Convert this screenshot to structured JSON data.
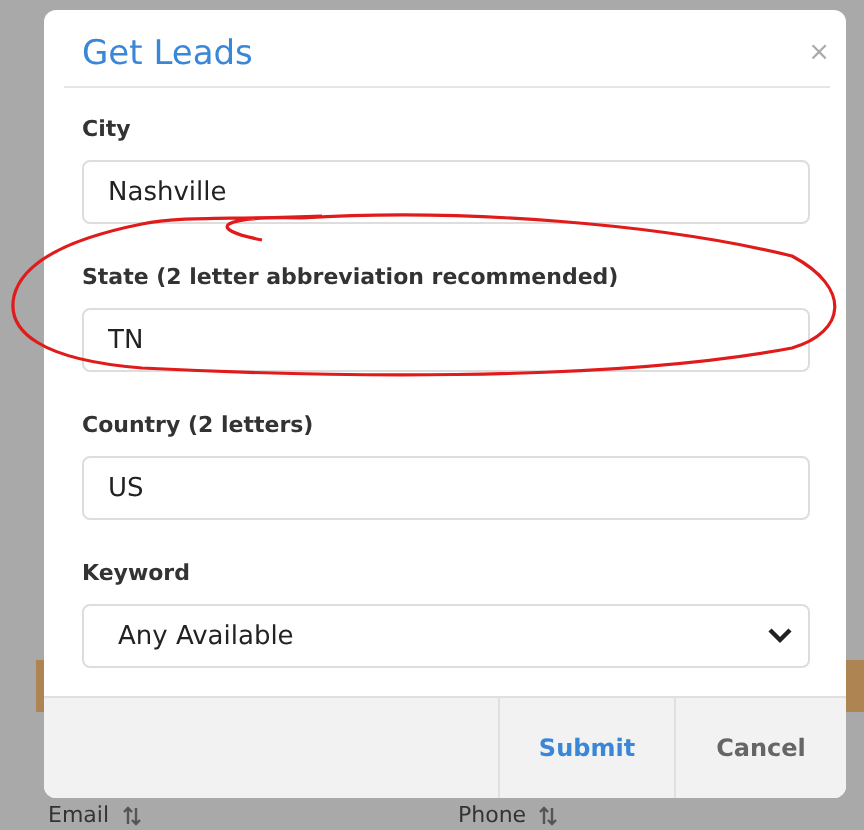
{
  "dialog": {
    "title": "Get Leads",
    "close": "×",
    "fields": [
      {
        "kind": "input",
        "label": "City",
        "value": "Nashville",
        "annotated": false
      },
      {
        "kind": "input",
        "label": "State (2 letter abbreviation recommended)",
        "value": "TN",
        "annotated": true
      },
      {
        "kind": "input",
        "label": "Country (2 letters)",
        "value": "US",
        "annotated": false
      },
      {
        "kind": "select",
        "label": "Keyword",
        "value": "Any Available",
        "annotated": false
      }
    ],
    "buttons": [
      {
        "label": "Submit",
        "primary": true
      },
      {
        "label": "Cancel",
        "primary": false
      }
    ]
  },
  "background_table": {
    "columns": [
      "Email",
      "Phone"
    ]
  }
}
